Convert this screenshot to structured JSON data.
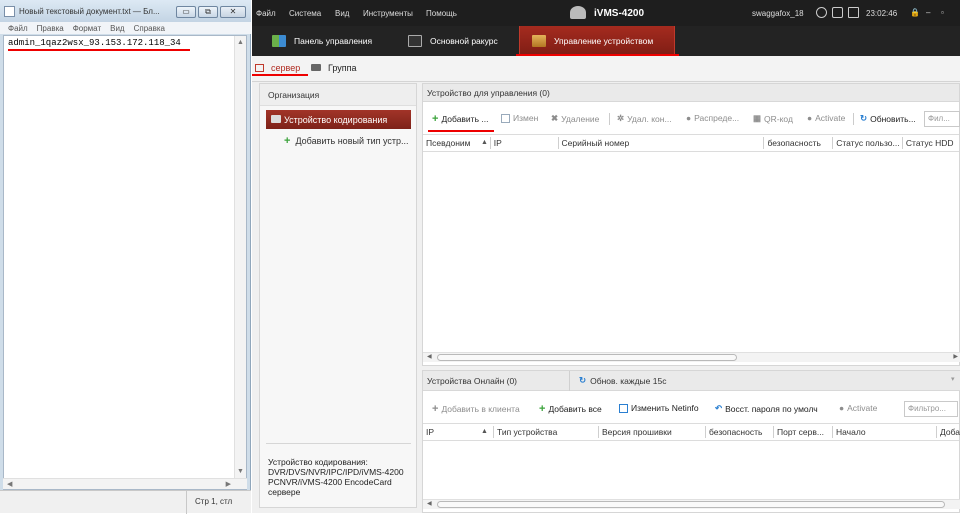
{
  "notepad": {
    "title": "Новый текстовый документ.txt — Бл...",
    "controls": {
      "minimize": "▭",
      "maximize": "⧉",
      "close": "✕"
    },
    "menu": [
      "Файл",
      "Правка",
      "Формат",
      "Вид",
      "Справка"
    ],
    "content": "admin_1qaz2wsx_93.153.172.118_34",
    "status": "Стр 1, стл"
  },
  "ivms": {
    "menu": [
      "Файл",
      "Система",
      "Вид",
      "Инструменты",
      "Помощь"
    ],
    "app_title": "iVMS-4200",
    "user": "swaggafox_18",
    "time": "23:02:46",
    "window_controls": [
      "🔒",
      "–",
      "▫"
    ],
    "tabs": [
      {
        "label": "Панель управления"
      },
      {
        "label": "Основной ракурс"
      },
      {
        "label": "Управление устройством"
      }
    ],
    "subtabs": {
      "server": "сервер",
      "group": "Группа"
    },
    "org": {
      "title": "Организация",
      "item_selected": "Устройство кодирования",
      "item_add": "Добавить новый тип устр...",
      "footer": "Устройство кодирования: DVR/DVS/NVR/IPC/IPD/iVMS-4200 PCNVR/iVMS-4200 EncodeCard сервере"
    },
    "manage": {
      "title": "Устройство для управления (0)",
      "toolbar": {
        "add": "Добавить ...",
        "edit": "Измен",
        "delete": "Удаление",
        "remote": "Удал. кон...",
        "distribute": "Распреде...",
        "qr": "QR-код",
        "activate": "Activate",
        "refresh": "Обновить...",
        "filter_placeholder": "Фил..."
      },
      "columns": [
        "Псевдоним",
        "IP",
        "Серийный номер",
        "безопасность",
        "Статус пользо...",
        "Статус HDD"
      ]
    },
    "online": {
      "title": "Устройства Онлайн (0)",
      "refresh": "Обнов. каждые 15с",
      "toolbar": {
        "add_client": "Добавить в клиента",
        "add_all": "Добавить все",
        "edit_netinfo": "Изменить Netinfo",
        "reset_pwd": "Восст. пароля по умолч",
        "activate": "Activate",
        "filter_placeholder": "Фильтро..."
      },
      "columns": [
        "IP",
        "Тип устройства",
        "Версия прошивки",
        "безопасность",
        "Порт серв...",
        "Начало",
        "Доба"
      ]
    }
  }
}
